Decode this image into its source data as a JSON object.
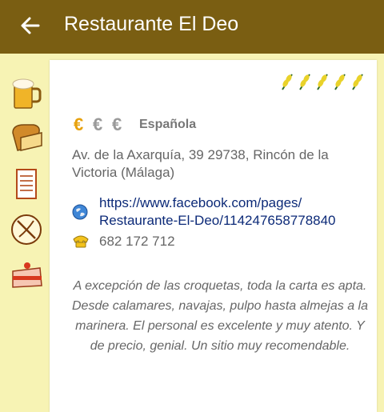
{
  "appbar": {
    "title": "Restaurante El Deo",
    "back_icon": "arrow-left-icon"
  },
  "sidebar": {
    "items": [
      {
        "icon": "beer-mug-icon"
      },
      {
        "icon": "bread-icon"
      },
      {
        "icon": "menu-list-icon"
      },
      {
        "icon": "gluten-free-icon"
      },
      {
        "icon": "cake-icon"
      }
    ]
  },
  "detail": {
    "rating": 5,
    "rating_icon": "wheat-icon",
    "price": {
      "symbols": [
        "€",
        "€",
        "€"
      ],
      "level": 1,
      "active_color": "#e7a10c",
      "inactive_color": "#9a9a9a"
    },
    "cuisine": "Española",
    "address": "Av. de la Axarquía, 39 29738, Rincón de la Victoria  (Málaga)",
    "website": {
      "line1": "https://www.facebook.com/pages/",
      "line2": "Restaurante-El-Deo/114247658778840"
    },
    "phone": "682 172 712",
    "review": "A excepción de las croquetas, toda la carta es apta. Desde calamares, navajas, pulpo hasta almejas a la marinera. El personal es excelente y muy atento. Y de precio, genial. Un sitio muy recomendable."
  },
  "colors": {
    "appbar": "#7a5e12",
    "background": "#f7f3b4",
    "link": "#0c2a78"
  }
}
